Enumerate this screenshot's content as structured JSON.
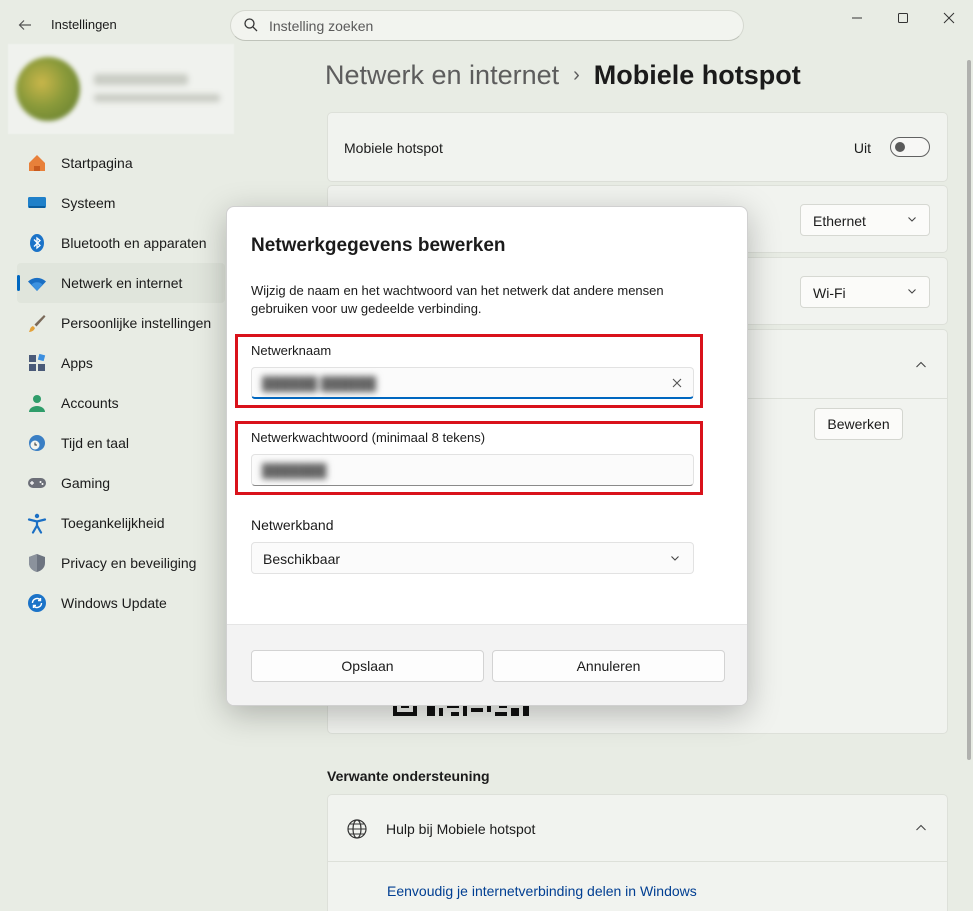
{
  "titlebar": {
    "app_title": "Instellingen",
    "search_placeholder": "Instelling zoeken",
    "window_controls": [
      "minimize",
      "maximize",
      "close"
    ]
  },
  "sidebar": {
    "items": [
      {
        "label": "Startpagina",
        "icon": "home-icon",
        "active": false
      },
      {
        "label": "Systeem",
        "icon": "monitor-icon",
        "active": false
      },
      {
        "label": "Bluetooth en apparaten",
        "icon": "bluetooth-icon",
        "active": false
      },
      {
        "label": "Netwerk en internet",
        "icon": "wifi-icon",
        "active": true
      },
      {
        "label": "Persoonlijke instellingen",
        "icon": "brush-icon",
        "active": false
      },
      {
        "label": "Apps",
        "icon": "apps-icon",
        "active": false
      },
      {
        "label": "Accounts",
        "icon": "person-icon",
        "active": false
      },
      {
        "label": "Tijd en taal",
        "icon": "clock-globe-icon",
        "active": false
      },
      {
        "label": "Gaming",
        "icon": "gamepad-icon",
        "active": false
      },
      {
        "label": "Toegankelijkheid",
        "icon": "accessibility-icon",
        "active": false
      },
      {
        "label": "Privacy en beveiliging",
        "icon": "shield-icon",
        "active": false
      },
      {
        "label": "Windows Update",
        "icon": "update-icon",
        "active": false
      }
    ]
  },
  "main": {
    "breadcrumb_parent": "Netwerk en internet",
    "breadcrumb_sep": "›",
    "page_title": "Mobiele hotspot",
    "hotspot_row": {
      "label": "Mobiele hotspot",
      "state": "Uit"
    },
    "share_from_value": "Ethernet",
    "share_over_value": "Wi-Fi",
    "edit_button": "Bewerken",
    "related_title": "Verwante ondersteuning",
    "help_title": "Hulp bij Mobiele hotspot",
    "help_link": "Eenvoudig je internetverbinding delen in Windows"
  },
  "dialog": {
    "title": "Netwerkgegevens bewerken",
    "description": "Wijzig de naam en het wachtwoord van het netwerk dat andere mensen gebruiken voor uw gedeelde verbinding.",
    "network_name_label": "Netwerknaam",
    "network_password_label": "Netwerkwachtwoord (minimaal 8 tekens)",
    "network_band_label": "Netwerkband",
    "network_band_value": "Beschikbaar",
    "save_button": "Opslaan",
    "cancel_button": "Annuleren"
  },
  "colors": {
    "accent": "#0067c0",
    "highlight": "#d9121b",
    "link": "#003e92"
  }
}
